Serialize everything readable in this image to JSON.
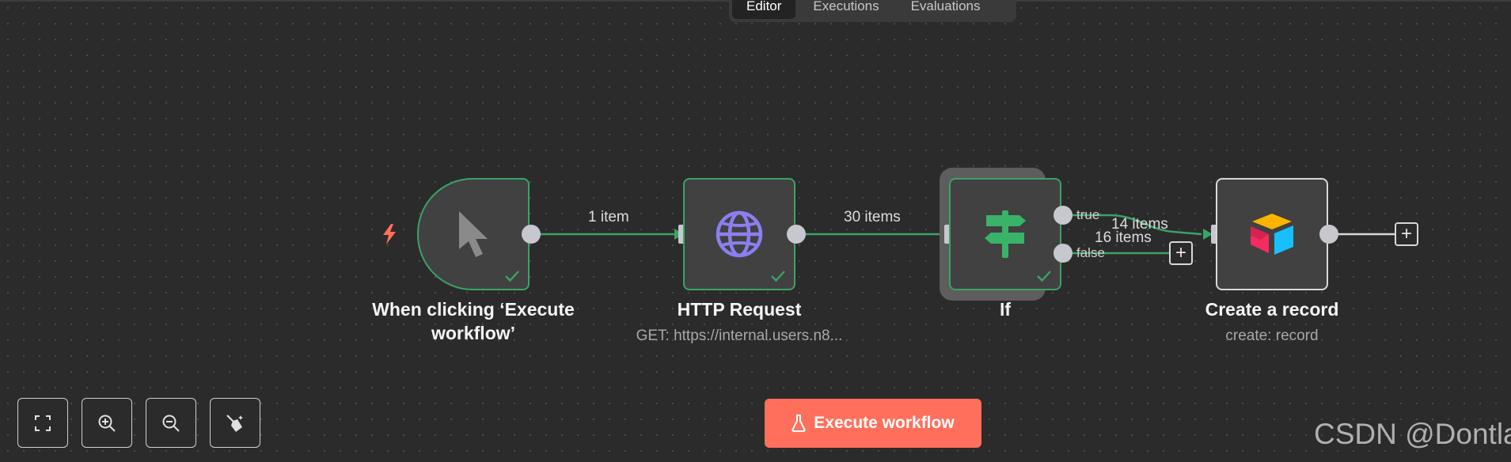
{
  "tabs": [
    {
      "label": "Editor",
      "active": true
    },
    {
      "label": "Executions",
      "active": false
    },
    {
      "label": "Evaluations",
      "active": false
    }
  ],
  "nodes": {
    "trigger": {
      "title": "When clicking ‘Execute workflow’",
      "icon": "cursor-icon"
    },
    "http": {
      "title": "HTTP Request",
      "subtitle": "GET: https://internal.users.n8...",
      "icon": "globe-icon"
    },
    "if": {
      "title": "If",
      "icon": "signpost-icon"
    },
    "airtable": {
      "title": "Create a record",
      "subtitle": "create: record",
      "icon": "airtable-icon"
    }
  },
  "edges": {
    "trigger_http": "1 item",
    "http_if": "30 items",
    "if_true": "14 items",
    "if_false": "16 items"
  },
  "branches": {
    "true_label": "true",
    "false_label": "false"
  },
  "execute_button": {
    "label": "Execute workflow"
  },
  "controls": [
    "fit-view",
    "zoom-in",
    "zoom-out",
    "tidy-up"
  ],
  "watermark": "CSDN @Dontla",
  "colors": {
    "success": "#3aa366",
    "accent": "#ff6f5c",
    "http_icon": "#8b7ff0",
    "if_icon": "#38b368",
    "trigger_bolt": "#ff6f5c"
  }
}
